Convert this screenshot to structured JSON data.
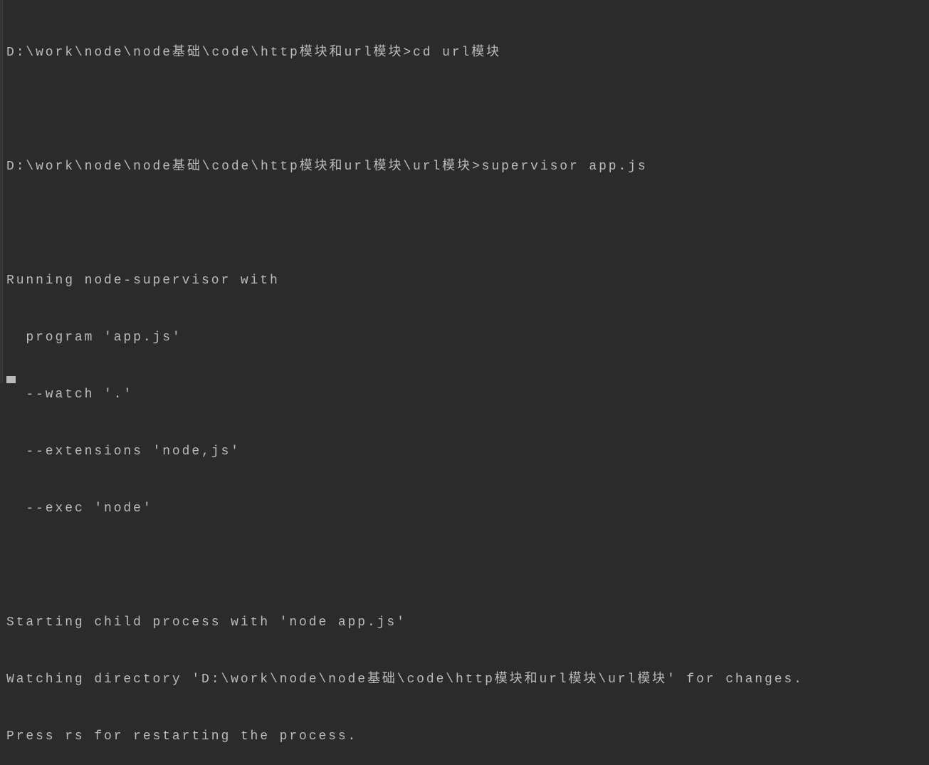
{
  "terminal": {
    "lines": [
      "D:\\work\\node\\node基础\\code\\http模块和url模块>cd url模块",
      "",
      "D:\\work\\node\\node基础\\code\\http模块和url模块\\url模块>supervisor app.js",
      "",
      "Running node-supervisor with",
      "  program 'app.js'",
      "  --watch '.'",
      "  --extensions 'node,js'",
      "  --exec 'node'",
      "",
      "Starting child process with 'node app.js'",
      "Watching directory 'D:\\work\\node\\node基础\\code\\http模块和url模块\\url模块' for changes.",
      "Press rs for restarting the process."
    ]
  },
  "colors": {
    "background": "#2b2b2b",
    "text": "#bbbbbb"
  }
}
